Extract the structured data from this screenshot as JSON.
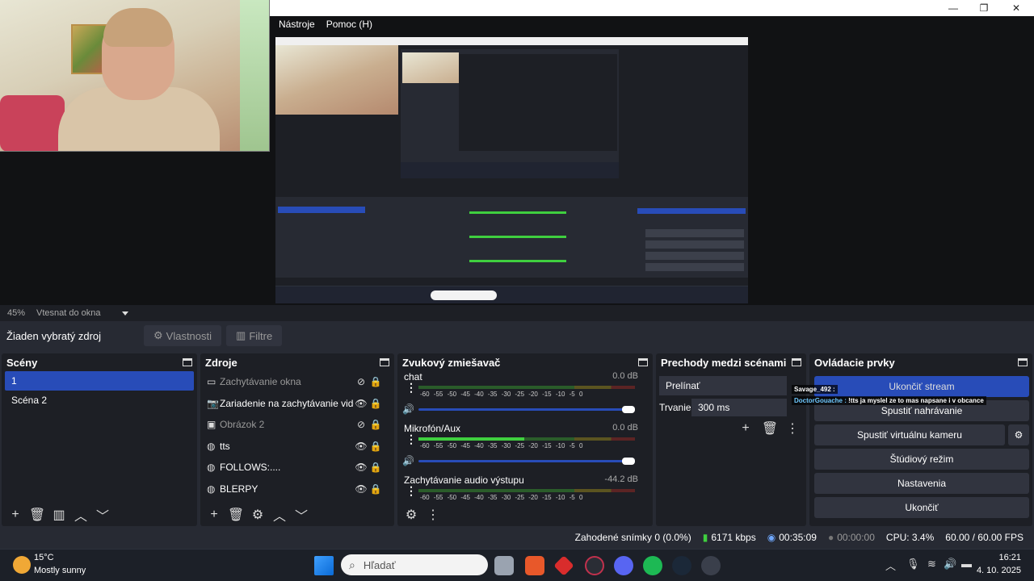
{
  "menu": {
    "items": [
      "Nástroje",
      "Pomoc (H)"
    ]
  },
  "preview": {
    "zoom_label": "45%",
    "zoom_mode": "Vtesnat do okna"
  },
  "source_toolbar": {
    "no_source": "Žiaden vybratý zdroj",
    "properties": "Vlastnosti",
    "filters": "Filtre"
  },
  "scenes": {
    "title": "Scény",
    "items": [
      "1",
      "Scéna 2"
    ]
  },
  "sources": {
    "title": "Zdroje",
    "items": [
      {
        "name": "Zachytávanie okna",
        "icon": "window-icon",
        "visible": false
      },
      {
        "name": "Zariadenie na zachytávanie videa",
        "icon": "camera-icon",
        "visible": true
      },
      {
        "name": "Obrázok 2",
        "icon": "image-icon",
        "visible": false
      },
      {
        "name": "tts",
        "icon": "browser-icon",
        "visible": true
      },
      {
        "name": "FOLLOWS:....",
        "icon": "browser-icon",
        "visible": true
      },
      {
        "name": "BLERPY",
        "icon": "browser-icon",
        "visible": true
      }
    ]
  },
  "mixer": {
    "title": "Zvukový zmiešavač",
    "ticks": "-60 -55 -50 -45 -40 -35 -30 -25 -20 -15 -10 -5 0",
    "channels": [
      {
        "name": "chat",
        "db": "0.0 dB",
        "level": 0.0
      },
      {
        "name": "Mikrofón/Aux",
        "db": "0.0 dB",
        "level": 0.49
      },
      {
        "name": "Zachytávanie audio výstupu",
        "db": "-44.2 dB",
        "level": 0.0
      }
    ]
  },
  "transitions": {
    "title": "Prechody medzi scénami",
    "current": "Prelínať",
    "duration_label": "Trvanie",
    "duration_value": "300 ms"
  },
  "controls": {
    "title": "Ovládacie prvky",
    "stop_stream": "Ukončiť stream",
    "start_recording": "Spustiť nahrávanie",
    "virtual_cam": "Spustiť virtuálnu kameru",
    "studio_mode": "Štúdiový režim",
    "settings": "Nastavenia",
    "exit": "Ukončiť"
  },
  "chat_overlay": {
    "line1_user": "Savage_492 :",
    "line2_user": "DoctorGouache :",
    "line2_text": "!tts ja myslel ze to mas napsane i v obcance"
  },
  "status": {
    "dropped": "Zahodené snímky 0 (0.0%)",
    "bitrate": "6171 kbps",
    "stream_time": "00:35:09",
    "rec_time": "00:00:00",
    "cpu": "CPU: 3.4%",
    "fps": "60.00 / 60.00 FPS"
  },
  "taskbar": {
    "weather_temp": "15°C",
    "weather_desc": "Mostly sunny",
    "search_placeholder": "Hľadať",
    "time": "16:21",
    "date": "4. 10. 2025"
  },
  "colors": {
    "selected": "#284cb8",
    "dock_bg": "#1d1f25",
    "panel_bg": "#272a33",
    "button_bg": "#31343f"
  }
}
